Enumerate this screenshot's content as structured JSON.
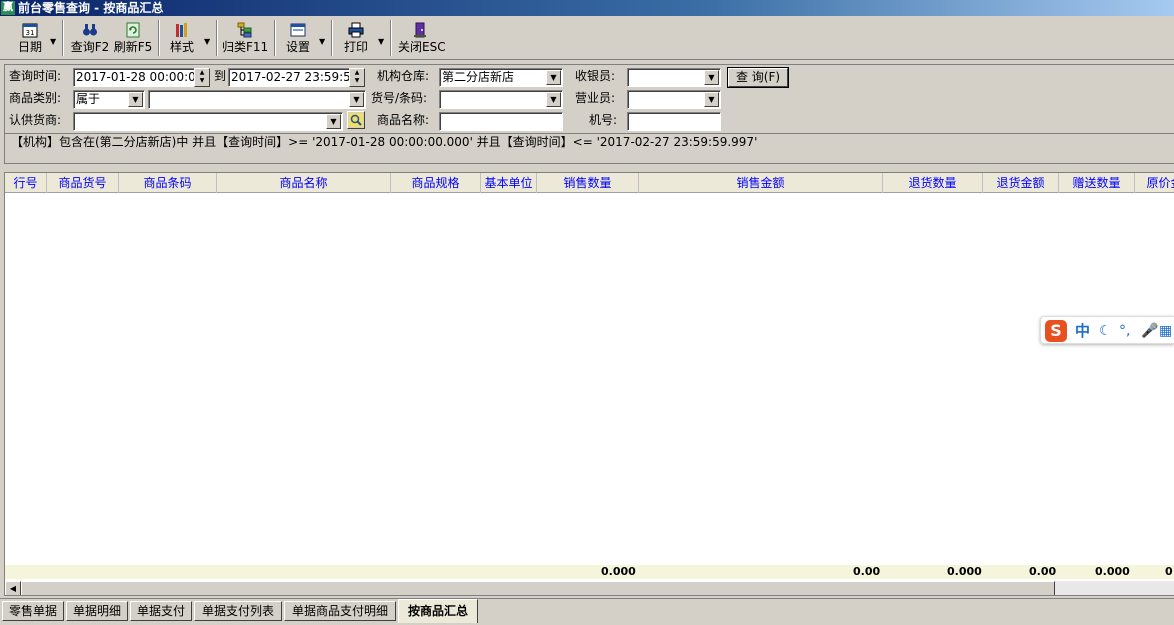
{
  "window": {
    "title": "前台零售查询 - 按商品汇总",
    "app_icon": "赢"
  },
  "toolbar": {
    "date_label": "日期",
    "query_label": "查询F2",
    "refresh_label": "刷新F5",
    "style_label": "样式",
    "group_label": "归类F11",
    "settings_label": "设置",
    "print_label": "打印",
    "close_label": "关闭ESC"
  },
  "filter": {
    "query_time_label": "查询时间:",
    "query_time_from": "2017-01-28 00:00:00",
    "to_label": "到",
    "query_time_to": "2017-02-27 23:59:59",
    "org_warehouse_label": "机构仓库:",
    "org_warehouse_value": "第二分店新店",
    "cashier_label": "收银员:",
    "cashier_value": "",
    "query_button_label": "查 询(F)",
    "category_label": "商品类别:",
    "category_op_value": "属于",
    "category_value": "",
    "item_code_label": "货号/条码:",
    "item_code_value": "",
    "salesperson_label": "营业员:",
    "salesperson_value": "",
    "supplier_label": "认供货商:",
    "supplier_value": "",
    "item_name_label": "商品名称:",
    "item_name_value": "",
    "machine_label": "机号:",
    "machine_value": ""
  },
  "condition_text": "【机构】包含在(第二分店新店)中 并且【查询时间】>= '2017-01-28 00:00:00.000' 并且【查询时间】<= '2017-02-27 23:59:59.997'",
  "grid": {
    "columns": [
      "行号",
      "商品货号",
      "商品条码",
      "商品名称",
      "商品规格",
      "基本单位",
      "销售数量",
      "销售金额",
      "退货数量",
      "退货金额",
      "赠送数量",
      "原价金"
    ],
    "totals": [
      "0.000",
      "0.00",
      "0.000",
      "0.00",
      "0.000",
      "0"
    ]
  },
  "ime": {
    "label": "中",
    "symbols": [
      "☾",
      "°,",
      "🎤",
      "▦"
    ]
  },
  "tabs": [
    "零售单据",
    "单据明细",
    "单据支付",
    "单据支付列表",
    "单据商品支付明细",
    "按商品汇总"
  ]
}
